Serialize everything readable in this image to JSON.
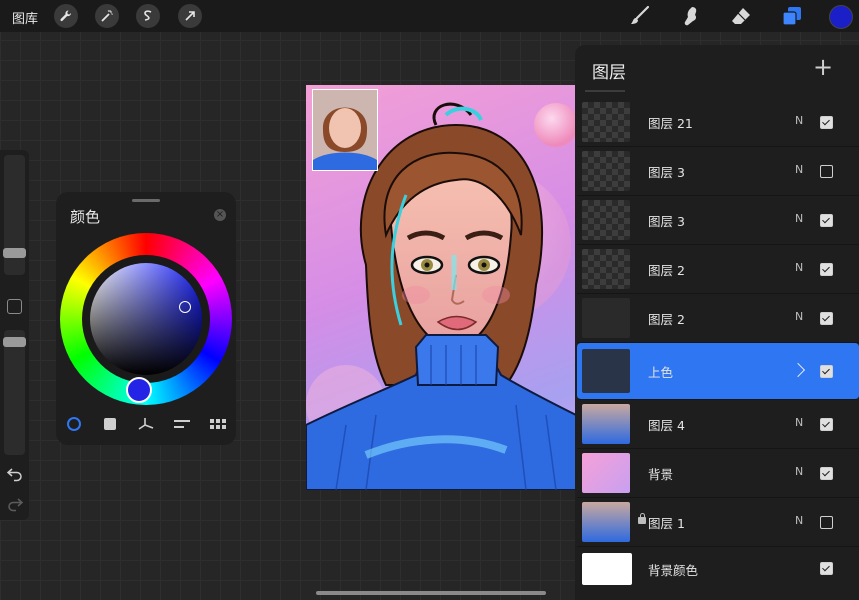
{
  "topbar": {
    "gallery_label": "图库",
    "left_tools": [
      "wrench-icon",
      "magic-wand-icon",
      "selection-s-icon",
      "transform-arrow-icon"
    ],
    "right_tools": [
      "brush-icon",
      "smudge-icon",
      "eraser-icon",
      "layers-icon"
    ],
    "current_color": "#1b1fc8"
  },
  "color_panel": {
    "title": "颜色",
    "modes": [
      "disc-mode-icon",
      "classic-mode-icon",
      "harmony-mode-icon",
      "value-mode-icon",
      "palette-mode-icon"
    ],
    "selected_color": "#2424e6"
  },
  "layers_panel": {
    "title": "图层",
    "add_label": "+",
    "layers": [
      {
        "name": "图层 21",
        "mode": "N",
        "visible": true,
        "thumb": "checker"
      },
      {
        "name": "图层 3",
        "mode": "N",
        "visible": false,
        "thumb": "checker"
      },
      {
        "name": "图层 3",
        "mode": "N",
        "visible": true,
        "thumb": "checker"
      },
      {
        "name": "图层 2",
        "mode": "N",
        "visible": true,
        "thumb": "checker"
      },
      {
        "name": "图层 2",
        "mode": "N",
        "visible": true,
        "thumb": "dark"
      },
      {
        "name": "上色",
        "mode": "",
        "visible": true,
        "thumb": "group",
        "active": true
      },
      {
        "name": "图层 4",
        "mode": "N",
        "visible": true,
        "thumb": "portrait"
      },
      {
        "name": "背景",
        "mode": "N",
        "visible": true,
        "thumb": "pink"
      },
      {
        "name": "图层 1",
        "mode": "N",
        "visible": false,
        "thumb": "portrait",
        "locked": true
      },
      {
        "name": "背景颜色",
        "mode": "",
        "visible": true,
        "thumb": "white"
      }
    ]
  },
  "colors": {
    "accent": "#2f76f3",
    "canvas_bg": "#262626",
    "panel_bg": "#1e1e1e"
  }
}
